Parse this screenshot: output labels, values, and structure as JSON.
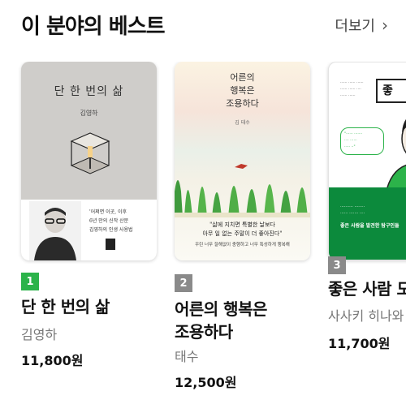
{
  "header": {
    "title": "이 분야의 베스트",
    "more_label": "더보기",
    "more_icon": "chevron-right-icon"
  },
  "books": [
    {
      "rank": "1",
      "rank_color": "#2cb34a",
      "title": "단 한 번의 삶",
      "author": "김영하",
      "price": "11,800원",
      "cover": {
        "title": "단 한 번의 삶",
        "author": "김영하",
        "quote_lines": [
          "'어쩌면 이곳, 이후",
          "6년 만의 신작 산문",
          "김영하의 인생 사용법"
        ]
      }
    },
    {
      "rank": "2",
      "rank_color": "#8a8a8a",
      "title_lines": [
        "어른의 행복은",
        "조용하다"
      ],
      "author": "태수",
      "price": "12,500원",
      "cover": {
        "title_lines": [
          "어른의",
          "행복은",
          "조용하다"
        ],
        "author": "김 태수",
        "quote_lines": [
          "\"삶에 지치면 특별한 날보다",
          "아무 일 없는 주말이 더 좋아진다\""
        ],
        "sub": "우린 너무 잘해없이 충행하고 너무 특성하게 행복해"
      }
    },
    {
      "rank": "3",
      "rank_color": "#8a8a8a",
      "title": "좋은 사람 도",
      "author": "사사키 히나와",
      "price": "11,700원",
      "cover": {
        "box": "좋",
        "band_text": "좋은 사람을 발견한 탐구인들"
      }
    }
  ]
}
